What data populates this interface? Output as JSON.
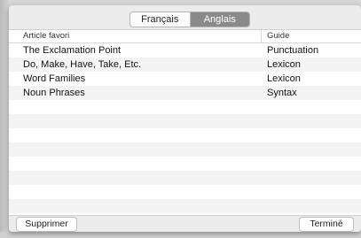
{
  "tabs": [
    {
      "label": "Français",
      "active": false
    },
    {
      "label": "Anglais",
      "active": true
    }
  ],
  "table": {
    "columns": [
      "Article favori",
      "Guide"
    ],
    "rows": [
      {
        "article": "The Exclamation Point",
        "guide": "Punctuation"
      },
      {
        "article": "Do, Make, Have, Take, Etc.",
        "guide": "Lexicon"
      },
      {
        "article": "Word Families",
        "guide": "Lexicon"
      },
      {
        "article": "Noun Phrases",
        "guide": "Syntax"
      }
    ]
  },
  "buttons": {
    "delete_label": "Supprimer",
    "done_label": "Terminé"
  }
}
